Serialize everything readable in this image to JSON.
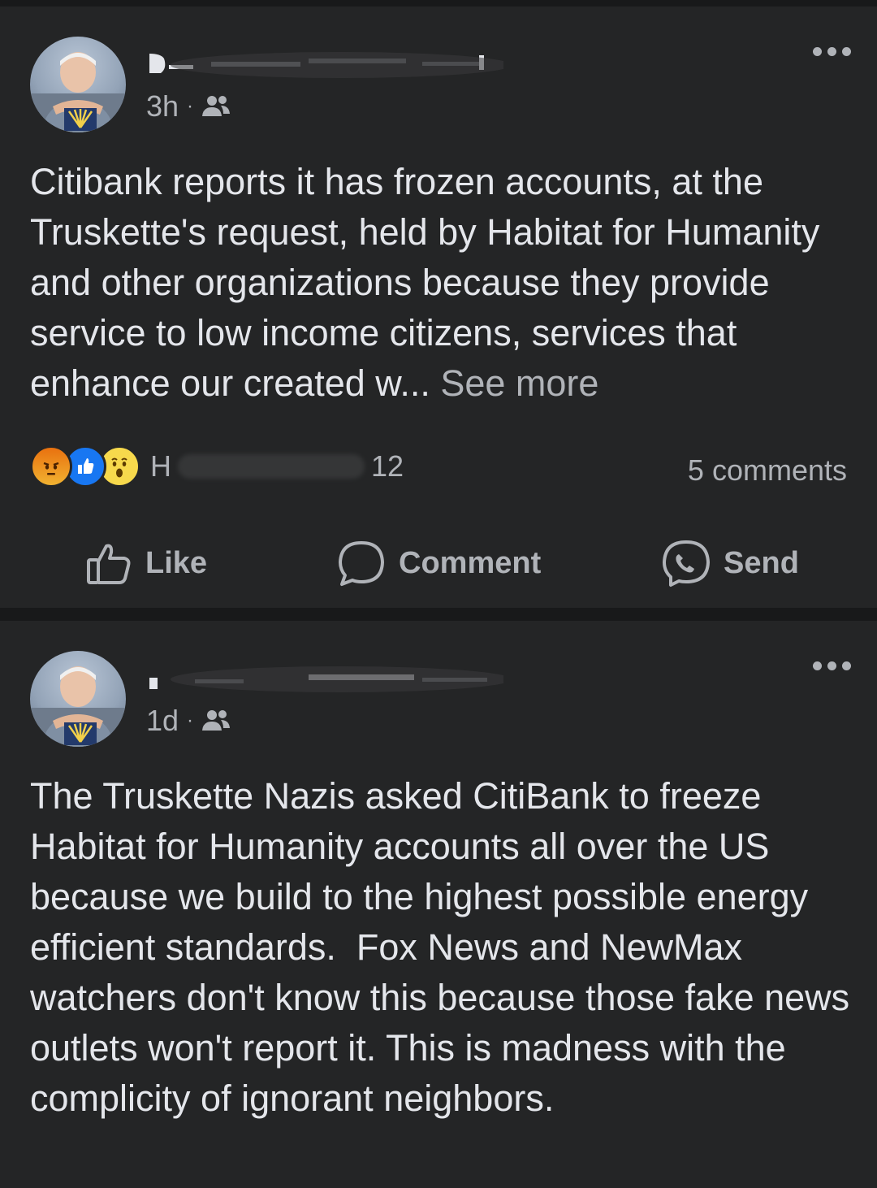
{
  "posts": [
    {
      "time": "3h",
      "separator": "·",
      "text": "Citibank reports it has frozen accounts, at the Truskette's request, held by Habitat for Humanity and other organizations because they provide service to low income citizens, services that enhance our created w... ",
      "see_more": "See more",
      "reaction_count": "12",
      "reaction_name_initial": "H",
      "comments": "5 comments",
      "actions": {
        "like": "Like",
        "comment": "Comment",
        "send": "Send"
      }
    },
    {
      "time": "1d",
      "separator": "·",
      "text": "The Truskette Nazis asked CitiBank to freeze Habitat for Humanity accounts all over the US because we build to the highest possible energy efficient standards.  Fox News and NewMax watchers don't know this because those fake news outlets won't report it. This is madness with the complicity of ignorant neighbors."
    }
  ],
  "icons": {
    "more": "more-horizontal-icon",
    "audience": "friends-icon",
    "reactions": [
      "angry-reaction-icon",
      "like-reaction-icon",
      "wow-reaction-icon"
    ],
    "like": "thumbs-up-icon",
    "comment": "speech-bubble-icon",
    "send": "messenger-icon"
  },
  "colors": {
    "background": "#18191a",
    "card": "#242526",
    "primary_text": "#e4e6eb",
    "secondary_text": "#b0b3b8",
    "like_blue": "#1877f2"
  }
}
